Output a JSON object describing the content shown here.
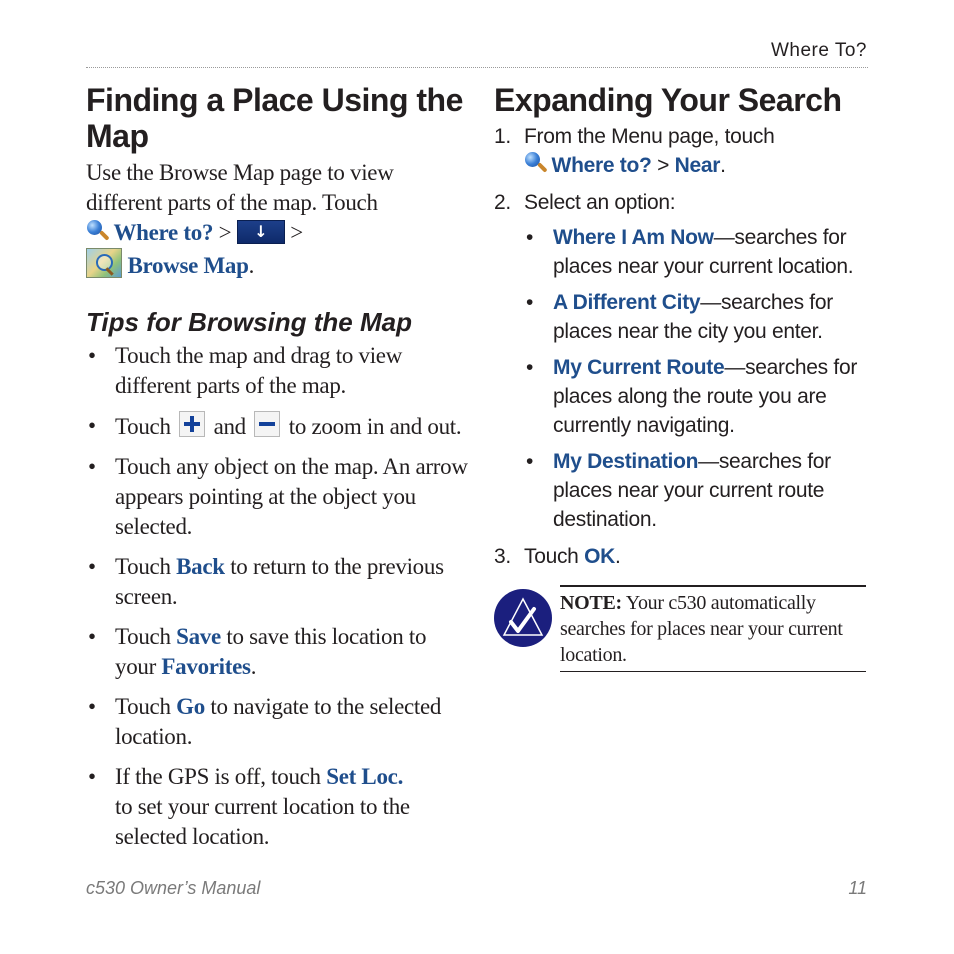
{
  "header": {
    "running_head": "Where To?"
  },
  "left": {
    "title": "Finding a Place Using the Map",
    "intro": "Use the Browse Map page to view different parts of the map. Touch",
    "path": {
      "where_to": "Where to?",
      "sep": ">",
      "down_arrow": "↓",
      "browse_map": "Browse Map",
      "end": "."
    },
    "tips_heading": "Tips for Browsing the Map",
    "tips": {
      "t1": "Touch the map and drag to view different parts of the map.",
      "t2_a": "Touch",
      "t2_b": "and",
      "t2_c": "to zoom in and out.",
      "t3": "Touch any object on the map. An arrow appears pointing at the object you selected.",
      "t4_a": "Touch",
      "t4_link": "Back",
      "t4_b": "to return to the previous screen.",
      "t5_a": "Touch",
      "t5_link": "Save",
      "t5_b": "to save this location to your",
      "t5_link2": "Favorites",
      "t5_end": ".",
      "t6_a": "Touch",
      "t6_link": "Go",
      "t6_b": "to navigate to the selected location.",
      "t7_a": "If the GPS is off, touch",
      "t7_link": "Set Loc.",
      "t7_b": "to set your current location to the selected location."
    }
  },
  "right": {
    "title": "Expanding Your Search",
    "steps": {
      "s1_num": "1.",
      "s1_text": "From the Menu page, touch",
      "s1_link1": "Where to?",
      "s1_sep": ">",
      "s1_link2": "Near",
      "s1_end": ".",
      "s2_num": "2.",
      "s2_text": "Select an option:",
      "s3_num": "3.",
      "s3_text": "Touch",
      "s3_link": "OK",
      "s3_end": "."
    },
    "options": [
      {
        "label": "Where I Am Now",
        "desc": "—searches for places near your current location."
      },
      {
        "label": "A Different City",
        "desc": "—searches for places near the city you enter."
      },
      {
        "label": "My Current Route",
        "desc": "—searches for places along the route you are currently navigating."
      },
      {
        "label": "My Destination",
        "desc": "—searches for places near your current route destination."
      }
    ],
    "note": {
      "label": "NOTE:",
      "text": " Your c530 automatically searches for places near your current location."
    }
  },
  "footer": {
    "manual": "c530 Owner’s Manual",
    "page": "11"
  }
}
